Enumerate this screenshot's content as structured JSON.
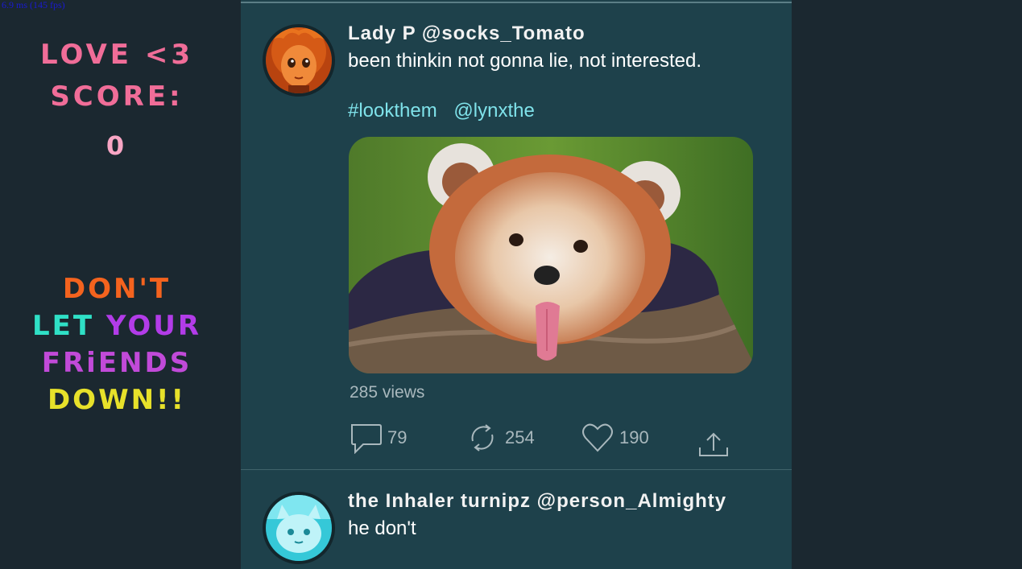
{
  "fps_readout": "6.9 ms (145 fps)",
  "hud": {
    "love_label": "LOVE <3",
    "score_label": "SCORE:",
    "score_value": "0",
    "motto_lines": [
      [
        {
          "t": "DON'T",
          "c": "#f4631e"
        }
      ],
      [
        {
          "t": "LET ",
          "c": "#2fe0c6"
        },
        {
          "t": "YOUR",
          "c": "#b23ce8"
        }
      ],
      [
        {
          "t": "FRiENDS",
          "c": "#c14ad8"
        }
      ],
      [
        {
          "t": "DOWN!!",
          "c": "#e7e12a"
        }
      ]
    ]
  },
  "tweets": [
    {
      "author": "Lady P @socks_Tomato",
      "text": "been thinkin not gonna lie, not interested.",
      "hashtag": "#lookthem",
      "mention": "@lynxthe",
      "views": "285 views",
      "replies": "79",
      "retweets": "254",
      "likes": "190",
      "avatar_icon": "girl-avatar-icon"
    },
    {
      "author": "the Inhaler turnipz @person_Almighty",
      "text": "he don't",
      "avatar_icon": "cat-avatar-icon"
    }
  ],
  "colors": {
    "page_bg": "#1b2830",
    "feed_bg": "#1e414b",
    "link": "#7fe2ea",
    "muted": "#a9b8bd",
    "hud_pink": "#f06d98"
  }
}
